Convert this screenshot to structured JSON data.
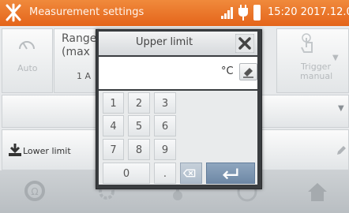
{
  "statusbar": {
    "title": "Measurement settings",
    "clock": "15:20 2017.12.06",
    "icons": [
      "tool-logo-icon",
      "signal-icon",
      "plug-icon",
      "battery-icon"
    ]
  },
  "background": {
    "auto_label": "Auto",
    "range_label": "Range\n(max",
    "range_value": "1 A",
    "trigger_label": "Trigger\nmanual",
    "lower_limit_label": "Lower limit"
  },
  "dialog": {
    "title": "Upper limit",
    "input_value": "",
    "unit": "°C",
    "keys": [
      "1",
      "2",
      "3",
      "4",
      "5",
      "6",
      "7",
      "8",
      "9",
      "0",
      "."
    ]
  },
  "colors": {
    "statusbar": "#e8702a",
    "dialog_frame": "#3a3d40",
    "enter_key": "#7b93b0"
  }
}
